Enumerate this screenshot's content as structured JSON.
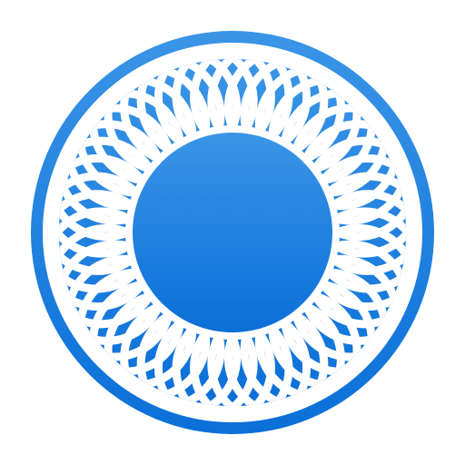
{
  "icon": {
    "name": "rosette-logo-icon",
    "colors": {
      "gradient_top": "#3a95e6",
      "gradient_bottom": "#0a6fd8",
      "lattice": "#ffffff",
      "background": "#ffffff"
    }
  }
}
